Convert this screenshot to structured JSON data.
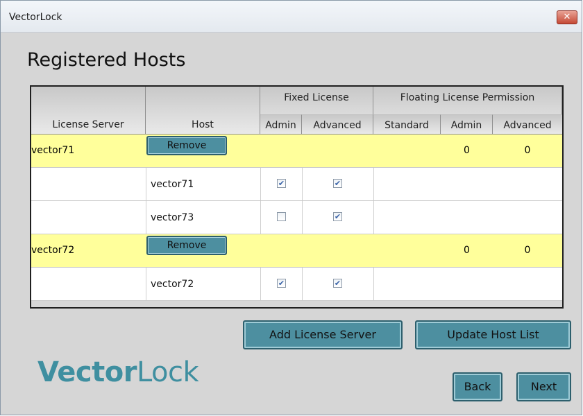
{
  "window": {
    "title": "VectorLock",
    "close_glyph": "✕"
  },
  "page_title": "Registered Hosts",
  "table": {
    "columns": {
      "license_server": "License Server",
      "host": "Host",
      "fixed_group": "Fixed License",
      "floating_group": "Floating License Permission",
      "fixed_admin": "Admin",
      "fixed_advanced": "Advanced",
      "float_standard": "Standard",
      "float_admin": "Admin",
      "float_advanced": "Advanced"
    },
    "rows": [
      {
        "type": "server",
        "name": "vector71",
        "button": "Remove",
        "admin": "0",
        "advanced": "0"
      },
      {
        "type": "host",
        "name": "vector71",
        "admin": true,
        "advanced": true
      },
      {
        "type": "host",
        "name": "vector73",
        "admin": false,
        "advanced": true
      },
      {
        "type": "server",
        "name": "vector72",
        "button": "Remove",
        "admin": "0",
        "advanced": "0"
      },
      {
        "type": "host",
        "name": "vector72",
        "admin": true,
        "advanced": true
      }
    ]
  },
  "buttons": {
    "add_license_server": "Add License Server",
    "update_host_list": "Update Host List",
    "back": "Back",
    "next": "Next"
  },
  "logo": {
    "part1": "Vector",
    "part2": "Lock"
  },
  "colors": {
    "server_row": "#ffff9b",
    "button": "#4d8fa0",
    "logo": "#3f8fa0"
  },
  "icons": [
    "close-icon",
    "checkbox-checked",
    "checkbox-unchecked",
    "vectorlock-logo"
  ]
}
